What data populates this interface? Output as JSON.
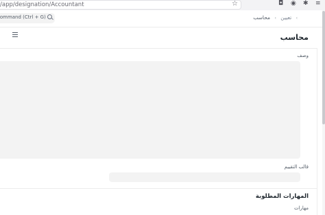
{
  "browser": {
    "url": "/app/designation/Accountant"
  },
  "navbar": {
    "search_text": "command (Ctrl + G)",
    "breadcrumb": [
      "تعيين",
      "محاسب"
    ]
  },
  "page": {
    "title": "محاسب"
  },
  "form": {
    "description_label": "وصف",
    "appraisal_template_label": "قالب التقييم",
    "section_title": "المهارات المطلوبة",
    "skills_label": "مهارات"
  }
}
